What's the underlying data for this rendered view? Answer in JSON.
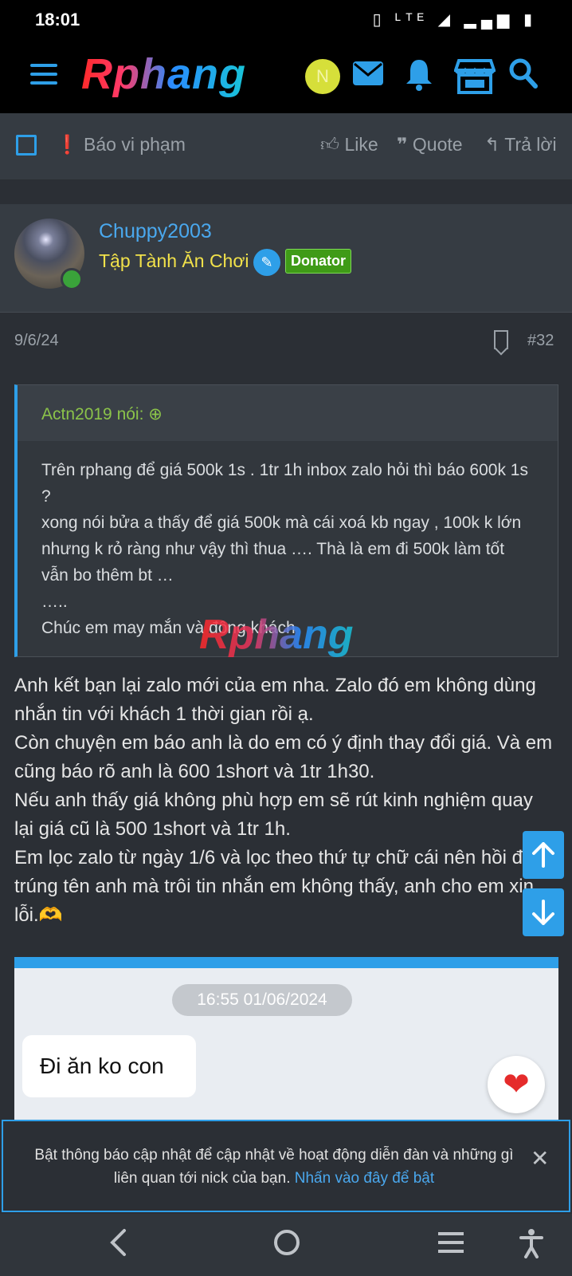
{
  "status_bar": {
    "time": "18:01",
    "icons_text": "▯ ᴸᵀᴱ ◢ ▂▄▆ ▮"
  },
  "top_nav": {
    "logo_text": "Rphang",
    "avatar_letter": "N",
    "icons": [
      "menu-icon",
      "mail-icon",
      "bell-icon",
      "store-icon",
      "search-icon"
    ],
    "accent_color": "#2e9fe8"
  },
  "action_bar": {
    "report": "Báo vi phạm",
    "like": "Like",
    "quote": "Quote",
    "reply": "Trả lời"
  },
  "author": {
    "username": "Chuppy2003",
    "title": "Tập Tành Ăn Chơi",
    "badge": "Donator"
  },
  "post_meta": {
    "date": "9/6/24",
    "number": "#32"
  },
  "quote": {
    "author_line": "Actn2019 nói:",
    "body": "Trên rphang để giá 500k 1s . 1tr 1h inbox zalo hỏi thì báo 600k 1s ?\nxong nói bửa a thấy để giá 500k mà cái xoá kb ngay , 100k k lớn nhưng k rỏ ràng như vậy thì thua …. Thà là em đi 500k làm tốt vẫn bo thêm bt …\n…..\nChúc em may mắn và đông khách"
  },
  "watermark": "Rphang",
  "post_body": "Anh kết bạn lại zalo mới của em nha. Zalo đó em không dùng nhắn tin với khách 1 thời gian rồi ạ.\nCòn chuyện em báo anh là do em có ý định thay đổi giá. Và em cũng báo rõ anh là 600 1short và 1tr 1h30.\nNếu anh thấy giá không phù hợp em sẽ rút kinh nghiệm quay lại giá cũ là 500 1short và 1tr 1h.\nEm lọc zalo từ ngày 1/6 và lọc theo thứ tự chữ cái nên hồi đó lỡ trúng tên anh mà trôi tin nhắn em không thấy, anh cho em xin lỗi.🫶",
  "chat_image": {
    "timestamp": "16:55 01/06/2024",
    "message": "Đi ăn ko con"
  },
  "notice": {
    "text": "Bật thông báo cập nhật để cập nhật về hoạt động diễn đàn và những gì liên quan tới nick của bạn.",
    "link": "Nhấn vào đây để bật"
  }
}
